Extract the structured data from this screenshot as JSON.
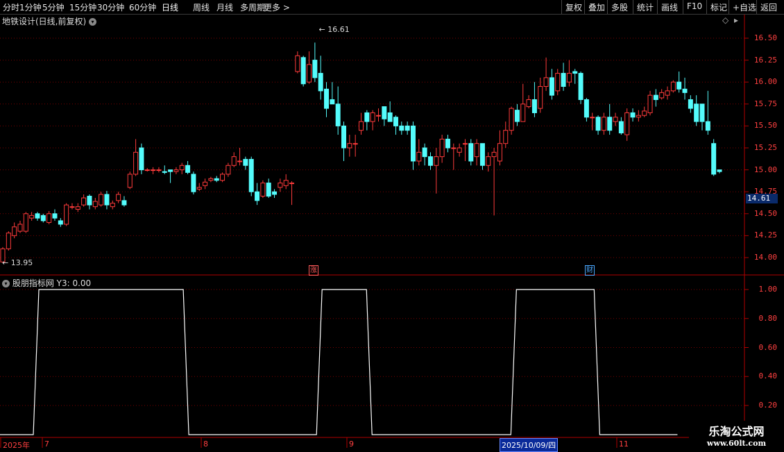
{
  "toolbar": {
    "left": [
      "分时",
      "1分钟",
      "5分钟",
      "15分钟",
      "30分钟",
      "60分钟",
      "日线",
      "周线",
      "月线",
      "多周期",
      "更多 >"
    ],
    "active": "日线",
    "right": [
      "复权",
      "叠加",
      "多股",
      "统计",
      "画线",
      "F10",
      "标记",
      "+自选",
      "返回"
    ]
  },
  "main_title": "地铁设计(日线,前复权)",
  "sub_title": "股朋指标网  Y3: 0.00",
  "price_axis": [
    "16.50",
    "16.25",
    "16.00",
    "15.75",
    "15.50",
    "15.25",
    "15.00",
    "14.75",
    "14.50",
    "14.25",
    "14.00"
  ],
  "price_tag": "14.61",
  "indicator_axis": [
    "1.00",
    "0.80",
    "0.60",
    "0.40",
    "0.20"
  ],
  "high_label": "16.61",
  "low_label": "13.95",
  "badges": [
    {
      "text": "涨",
      "color": "#ff5a5a"
    },
    {
      "text": "财",
      "color": "#4aa8ff"
    }
  ],
  "dates": [
    "2025年",
    "7",
    "8",
    "9",
    "10",
    "11"
  ],
  "date_cursor": "2025/10/09/四",
  "watermark": {
    "line1": "乐淘公式网",
    "line2": "www.60lt.com"
  },
  "colors": {
    "up": "#ff3b3b",
    "down": "#54fcfc",
    "grid": "#7a0000",
    "border": "#b00000",
    "line": "#ffffff"
  },
  "chart_data": {
    "type": "candlestick",
    "ylim": [
      13.9,
      16.7
    ],
    "candles": [
      [
        13.95,
        14.1,
        14.12,
        13.95
      ],
      [
        14.1,
        14.28,
        14.3,
        14.08
      ],
      [
        14.25,
        14.35,
        14.4,
        14.22
      ],
      [
        14.3,
        14.38,
        14.42,
        14.28
      ],
      [
        14.3,
        14.5,
        14.52,
        14.28
      ],
      [
        14.45,
        14.48,
        14.52,
        14.42
      ],
      [
        14.5,
        14.45,
        14.52,
        14.42
      ],
      [
        14.48,
        14.42,
        14.5,
        14.4
      ],
      [
        14.4,
        14.5,
        14.53,
        14.38
      ],
      [
        14.5,
        14.45,
        14.55,
        14.42
      ],
      [
        14.42,
        14.38,
        14.45,
        14.35
      ],
      [
        14.38,
        14.6,
        14.62,
        14.36
      ],
      [
        14.58,
        14.58,
        14.62,
        14.55
      ],
      [
        14.55,
        14.58,
        14.62,
        14.52
      ],
      [
        14.6,
        14.68,
        14.72,
        14.58
      ],
      [
        14.7,
        14.6,
        14.72,
        14.55
      ],
      [
        14.58,
        14.64,
        14.68,
        14.55
      ],
      [
        14.6,
        14.72,
        14.75,
        14.58
      ],
      [
        14.72,
        14.6,
        14.76,
        14.55
      ],
      [
        14.58,
        14.62,
        14.65,
        14.55
      ],
      [
        14.65,
        14.72,
        14.75,
        14.62
      ],
      [
        14.65,
        14.6,
        14.7,
        14.58
      ],
      [
        14.8,
        14.95,
        14.98,
        14.78
      ],
      [
        14.95,
        15.2,
        15.35,
        14.93
      ],
      [
        15.25,
        15.0,
        15.3,
        14.95
      ],
      [
        15.0,
        15.0,
        15.02,
        14.98
      ],
      [
        15.0,
        15.0,
        15.03,
        14.95
      ],
      [
        15.0,
        15.0,
        15.03,
        14.97
      ],
      [
        14.98,
        14.97,
        15.05,
        14.95
      ],
      [
        15.0,
        14.98,
        15.0,
        14.85
      ],
      [
        14.98,
        15.0,
        15.03,
        14.95
      ],
      [
        15.0,
        15.05,
        15.08,
        14.95
      ],
      [
        15.05,
        14.97,
        15.1,
        14.95
      ],
      [
        14.95,
        14.75,
        14.98,
        14.72
      ],
      [
        14.78,
        14.8,
        14.85,
        14.76
      ],
      [
        14.82,
        14.86,
        14.9,
        14.78
      ],
      [
        14.88,
        14.9,
        14.92,
        14.86
      ],
      [
        14.9,
        14.88,
        14.93,
        14.86
      ],
      [
        14.88,
        14.95,
        14.97,
        14.86
      ],
      [
        14.95,
        15.05,
        15.08,
        14.92
      ],
      [
        15.05,
        15.15,
        15.2,
        15.03
      ],
      [
        15.1,
        15.1,
        15.25,
        15.05
      ],
      [
        15.12,
        15.05,
        15.15,
        15.0
      ],
      [
        15.12,
        14.75,
        15.15,
        14.7
      ],
      [
        14.75,
        14.65,
        14.85,
        14.6
      ],
      [
        14.7,
        14.85,
        14.88,
        14.68
      ],
      [
        14.85,
        14.7,
        14.9,
        14.68
      ],
      [
        14.75,
        14.72,
        14.78,
        14.68
      ],
      [
        14.8,
        14.85,
        14.9,
        14.75
      ],
      [
        14.82,
        14.88,
        14.95,
        14.78
      ],
      [
        14.85,
        14.85,
        14.87,
        14.6
      ],
      [
        16.12,
        16.3,
        16.35,
        16.1
      ],
      [
        16.28,
        15.98,
        16.3,
        15.95
      ],
      [
        16.0,
        16.2,
        16.35,
        15.98
      ],
      [
        16.25,
        16.05,
        16.45,
        16.0
      ],
      [
        16.1,
        15.9,
        16.3,
        15.8
      ],
      [
        15.92,
        15.7,
        16.0,
        15.6
      ],
      [
        15.8,
        15.75,
        16.0,
        15.75
      ],
      [
        15.75,
        15.5,
        15.95,
        15.4
      ],
      [
        15.5,
        15.25,
        15.55,
        15.1
      ],
      [
        15.25,
        15.3,
        15.4,
        15.15
      ],
      [
        15.3,
        15.3,
        15.4,
        15.15
      ],
      [
        15.45,
        15.55,
        15.65,
        15.4
      ],
      [
        15.65,
        15.55,
        15.68,
        15.45
      ],
      [
        15.55,
        15.65,
        15.68,
        15.45
      ],
      [
        15.62,
        15.62,
        15.7,
        15.55
      ],
      [
        15.72,
        15.58,
        15.72,
        15.5
      ],
      [
        15.65,
        15.55,
        15.78,
        15.55
      ],
      [
        15.6,
        15.5,
        15.62,
        15.4
      ],
      [
        15.5,
        15.45,
        15.55,
        15.4
      ],
      [
        15.5,
        15.45,
        15.55,
        15.4
      ],
      [
        15.5,
        15.1,
        15.55,
        15.0
      ],
      [
        15.1,
        15.2,
        15.35,
        15.05
      ],
      [
        15.25,
        15.15,
        15.3,
        15.05
      ],
      [
        15.15,
        15.05,
        15.2,
        15.0
      ],
      [
        15.05,
        15.15,
        15.25,
        14.73
      ],
      [
        15.15,
        15.35,
        15.4,
        15.08
      ],
      [
        15.35,
        15.25,
        15.4,
        15.2
      ],
      [
        15.25,
        15.25,
        15.3,
        15.0
      ],
      [
        15.2,
        15.25,
        15.3,
        15.15
      ],
      [
        15.3,
        15.3,
        15.35,
        15.1
      ],
      [
        15.3,
        15.1,
        15.35,
        15.05
      ],
      [
        15.15,
        15.3,
        15.35,
        15.05
      ],
      [
        15.3,
        15.05,
        15.3,
        15.0
      ],
      [
        15.05,
        15.15,
        15.2,
        14.98
      ],
      [
        15.15,
        15.2,
        15.25,
        14.48
      ],
      [
        15.1,
        15.3,
        15.45,
        15.05
      ],
      [
        15.3,
        15.45,
        15.55,
        15.25
      ],
      [
        15.45,
        15.7,
        15.72,
        15.4
      ],
      [
        15.68,
        15.55,
        15.75,
        15.5
      ],
      [
        15.55,
        15.75,
        15.98,
        15.55
      ],
      [
        15.72,
        15.8,
        15.85,
        15.7
      ],
      [
        15.8,
        15.65,
        16.0,
        15.6
      ],
      [
        15.7,
        15.95,
        16.05,
        15.65
      ],
      [
        15.95,
        16.05,
        16.28,
        15.9
      ],
      [
        16.05,
        15.85,
        16.15,
        15.8
      ],
      [
        15.9,
        16.1,
        16.15,
        15.85
      ],
      [
        16.1,
        15.95,
        16.22,
        15.9
      ],
      [
        16.0,
        16.1,
        16.25,
        15.95
      ],
      [
        16.12,
        16.1,
        16.15,
        15.98
      ],
      [
        16.1,
        15.8,
        16.12,
        15.75
      ],
      [
        15.8,
        15.6,
        15.82,
        15.55
      ],
      [
        15.6,
        15.6,
        15.65,
        15.45
      ],
      [
        15.6,
        15.45,
        15.62,
        15.4
      ],
      [
        15.45,
        15.6,
        15.65,
        15.4
      ],
      [
        15.6,
        15.45,
        15.75,
        15.4
      ],
      [
        15.55,
        15.6,
        15.65,
        15.5
      ],
      [
        15.55,
        15.42,
        15.6,
        15.4
      ],
      [
        15.4,
        15.65,
        15.7,
        15.33
      ],
      [
        15.65,
        15.6,
        15.7,
        15.55
      ],
      [
        15.6,
        15.62,
        15.68,
        15.55
      ],
      [
        15.62,
        15.67,
        15.72,
        15.6
      ],
      [
        15.65,
        15.85,
        15.9,
        15.62
      ],
      [
        15.85,
        15.8,
        15.92,
        15.72
      ],
      [
        15.82,
        15.88,
        15.92,
        15.8
      ],
      [
        15.85,
        15.9,
        15.95,
        15.8
      ],
      [
        15.9,
        16.0,
        16.02,
        15.88
      ],
      [
        16.0,
        15.92,
        16.12,
        15.88
      ],
      [
        15.92,
        15.88,
        16.05,
        15.8
      ],
      [
        15.8,
        15.7,
        15.85,
        15.65
      ],
      [
        15.75,
        15.55,
        15.85,
        15.5
      ],
      [
        15.75,
        15.55,
        15.75,
        15.45
      ],
      [
        15.55,
        15.45,
        15.9,
        15.4
      ],
      [
        15.3,
        14.95,
        15.35,
        14.93
      ],
      [
        15.0,
        14.98,
        15.0,
        14.96
      ]
    ],
    "indicator_y3": [
      0,
      0,
      0,
      0,
      0,
      0,
      0,
      1,
      1,
      1,
      1,
      1,
      1,
      1,
      1,
      1,
      1,
      1,
      1,
      1,
      1,
      1,
      1,
      1,
      1,
      1,
      1,
      1,
      1,
      1,
      1,
      1,
      1,
      1,
      0,
      0,
      0,
      0,
      0,
      0,
      0,
      0,
      0,
      0,
      0,
      0,
      0,
      0,
      0,
      0,
      0,
      0,
      0,
      0,
      0,
      0,
      0,
      0,
      1,
      1,
      1,
      1,
      1,
      1,
      1,
      1,
      1,
      0,
      0,
      0,
      0,
      0,
      0,
      0,
      0,
      0,
      0,
      0,
      0,
      0,
      0,
      0,
      0,
      0,
      0,
      0,
      0,
      0,
      0,
      0,
      0,
      0,
      0,
      1,
      1,
      1,
      1,
      1,
      1,
      1,
      1,
      1,
      1,
      1,
      1,
      1,
      1,
      1,
      0,
      0,
      0,
      0,
      0,
      0,
      0,
      0,
      0,
      0,
      0,
      0,
      0,
      0,
      0
    ]
  }
}
